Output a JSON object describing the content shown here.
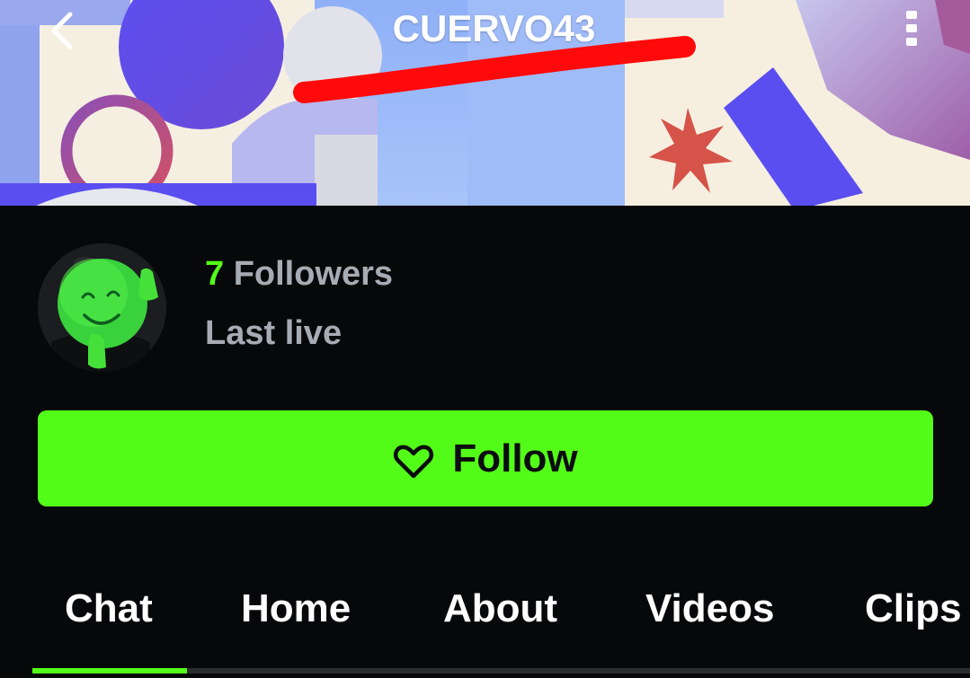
{
  "header": {
    "title": "CUERVO43",
    "back_icon": "chevron-left-icon",
    "menu_icon": "more-vertical-icon"
  },
  "profile": {
    "follower_count": "7",
    "followers_label": "Followers",
    "last_live_label": "Last live",
    "avatar_icon": "green-smiley-mascot-avatar"
  },
  "follow_button": {
    "label": "Follow",
    "icon": "heart-outline-icon"
  },
  "tabs": [
    {
      "label": "Chat",
      "active": true
    },
    {
      "label": "Home",
      "active": false
    },
    {
      "label": "About",
      "active": false
    },
    {
      "label": "Videos",
      "active": false
    },
    {
      "label": "Clips",
      "active": false
    }
  ],
  "colors": {
    "accent": "#53fc18",
    "background": "#07080a",
    "muted_text": "#a7abb3",
    "banner_blue": "#5a4ef0",
    "banner_cream": "#f7f0e1",
    "annotation_red": "#ff0a0a"
  }
}
